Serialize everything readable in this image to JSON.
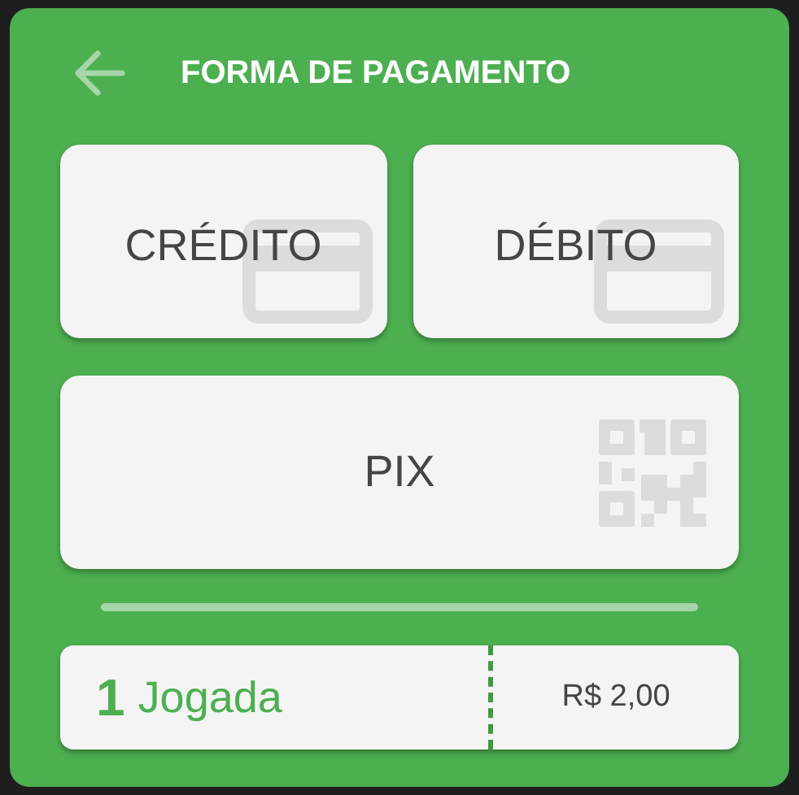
{
  "header": {
    "title": "FORMA DE PAGAMENTO"
  },
  "payment_methods": [
    {
      "label": "CRÉDITO",
      "kind": "card"
    },
    {
      "label": "DÉBITO",
      "kind": "card"
    },
    {
      "label": "PIX",
      "kind": "qr"
    }
  ],
  "summary": {
    "quantity": "1",
    "unit": "Jogada",
    "price": "R$ 2,00"
  }
}
